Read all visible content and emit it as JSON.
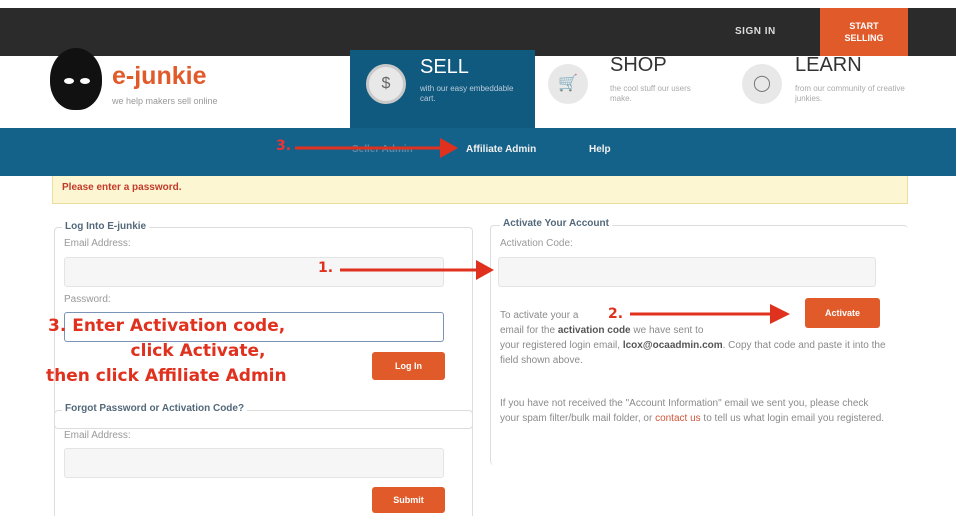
{
  "topbar": {
    "sign_in": "SIGN IN",
    "start_selling_line1": "START",
    "start_selling_line2": "SELLING"
  },
  "logo": {
    "name": "e-junkie",
    "tagline": "we help makers sell online"
  },
  "sections": {
    "sell": {
      "title": "SELL",
      "sub": "with our easy embeddable cart."
    },
    "shop": {
      "title": "SHOP",
      "sub": "the cool stuff our users make."
    },
    "learn": {
      "title": "LEARN",
      "sub": "from our community of creative junkies."
    }
  },
  "nav": {
    "seller_admin": "Seller Admin",
    "affiliate_admin": "Affiliate Admin",
    "help": "Help"
  },
  "alert": "Please enter a password.",
  "login": {
    "legend": "Log Into E-junkie",
    "email_label": "Email Address:",
    "password_label": "Password:",
    "login_button": "Log In"
  },
  "forgot": {
    "legend": "Forgot Password or Activation Code?",
    "email_label": "Email Address:",
    "submit_button": "Submit"
  },
  "activate": {
    "legend": "Activate Your Account",
    "code_label": "Activation Code:",
    "button": "Activate",
    "instr_pre": "To activate your a",
    "instr_line2_pre": "email for the ",
    "instr_line2_bold": "activation code",
    "instr_line2_post": " we have sent to",
    "instr_line3_pre": "your registered login email, ",
    "instr_line3_email": "lcox@ocaadmin.com",
    "instr_line3_post": ". Copy that code and paste it into the field shown above.",
    "not_received_pre": "If you have not received the \"Account Information\" email we sent you, please check your spam filter/bulk mail folder, or ",
    "contact_link": "contact us",
    "not_received_post": " to tell us what login email you registered."
  },
  "annotations": {
    "step1": "1.",
    "step2": "2.",
    "step3_nav": "3.",
    "step3_line1": "3. Enter Activation code,",
    "step3_line2": "click Activate,",
    "step3_line3": "then click Affiliate Admin"
  },
  "colors": {
    "brand_orange": "#e05a2a",
    "nav_blue": "#14628a",
    "sell_blue": "#0f5a7e",
    "annotation_red": "#e0301e"
  }
}
